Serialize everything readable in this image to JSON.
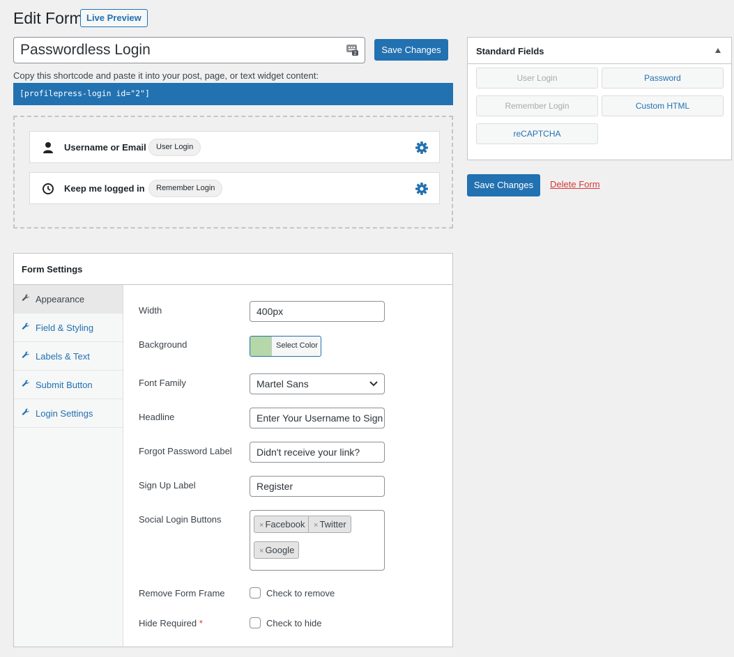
{
  "header": {
    "title": "Edit Form",
    "live_preview": "Live Preview"
  },
  "form_name": "Passwordless Login",
  "save_label": "Save Changes",
  "shortcode_hint": "Copy this shortcode and paste it into your post, page, or text widget content:",
  "shortcode": "[profilepress-login id=\"2\"]",
  "builder_fields": [
    {
      "label": "Username or Email",
      "badge": "User Login",
      "icon": "user-icon"
    },
    {
      "label": "Keep me logged in",
      "badge": "Remember Login",
      "icon": "clock-icon"
    }
  ],
  "standard_fields": {
    "title": "Standard Fields",
    "buttons": [
      {
        "label": "User Login",
        "enabled": false
      },
      {
        "label": "Password",
        "enabled": true
      },
      {
        "label": "Remember Login",
        "enabled": false
      },
      {
        "label": "Custom HTML",
        "enabled": true
      },
      {
        "label": "reCAPTCHA",
        "enabled": true
      }
    ]
  },
  "delete_form": "Delete Form",
  "settings": {
    "title": "Form Settings",
    "tabs": [
      "Appearance",
      "Field & Styling",
      "Labels & Text",
      "Submit Button",
      "Login Settings"
    ],
    "active_tab": "Appearance",
    "width_label": "Width",
    "width_value": "400px",
    "background_label": "Background",
    "background_color": "#b6d7a8",
    "select_color": "Select Color",
    "font_family_label": "Font Family",
    "font_family_value": "Martel Sans",
    "headline_label": "Headline",
    "headline_value": "Enter Your Username to Sign In",
    "forgot_label": "Forgot Password Label",
    "forgot_value": "Didn't receive your link?",
    "signup_label": "Sign Up Label",
    "signup_value": "Register",
    "social_label": "Social Login Buttons",
    "social_tags": [
      "Facebook",
      "Twitter",
      "Google"
    ],
    "remove_frame_label": "Remove Form Frame",
    "remove_frame_cb": "Check to remove",
    "hide_required_label": "Hide Required",
    "hide_required_star": "*",
    "hide_required_cb": "Check to hide"
  },
  "colors": {
    "primary": "#2271b1",
    "danger": "#d63638"
  }
}
